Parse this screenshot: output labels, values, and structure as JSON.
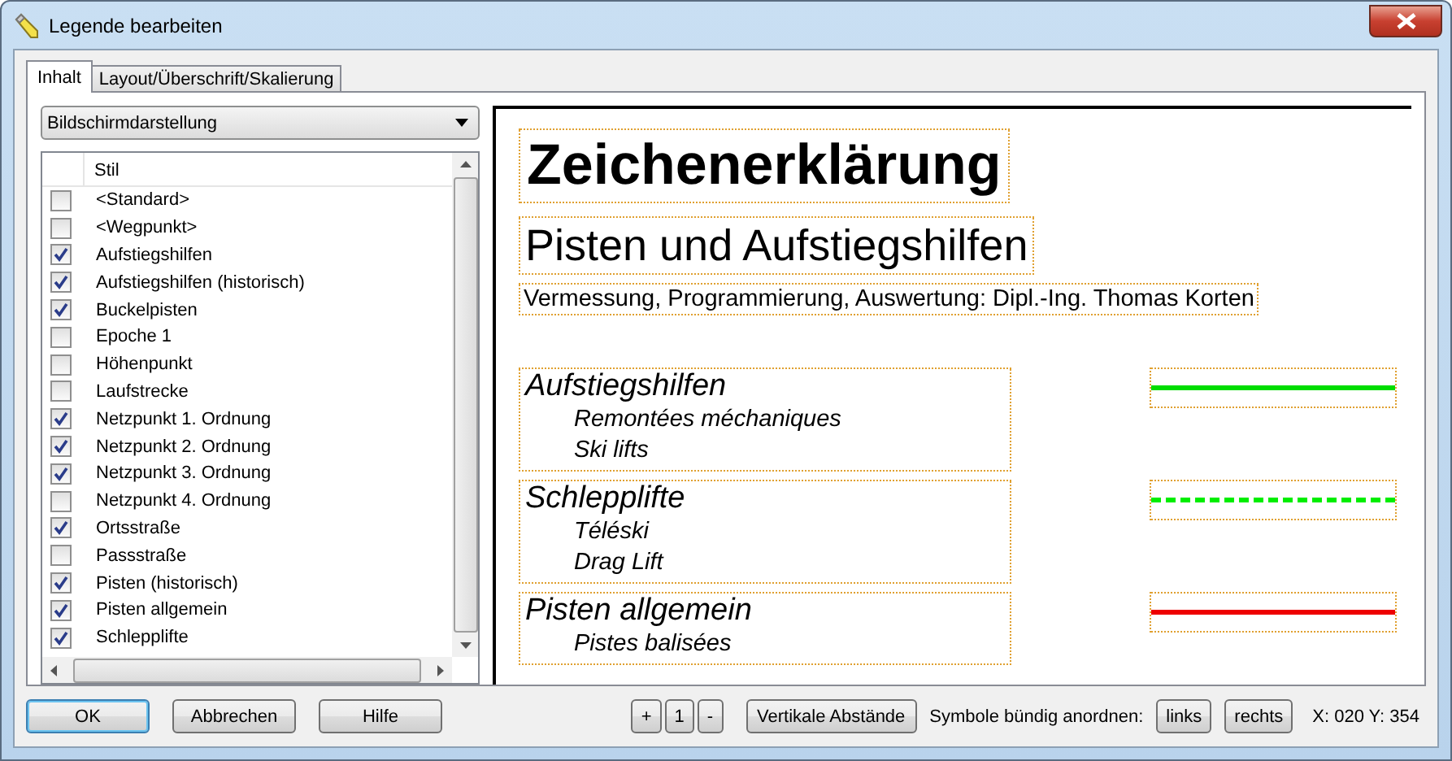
{
  "window": {
    "title": "Legende bearbeiten"
  },
  "tabs": [
    {
      "label": "Inhalt",
      "selected": true
    },
    {
      "label": "Layout/Überschrift/Skalierung",
      "selected": false
    }
  ],
  "dropdown": {
    "value": "Bildschirmdarstellung"
  },
  "style_list": {
    "column": "Stil",
    "items": [
      {
        "label": "<Standard>",
        "checked": false
      },
      {
        "label": "<Wegpunkt>",
        "checked": false
      },
      {
        "label": "Aufstiegshilfen",
        "checked": true
      },
      {
        "label": "Aufstiegshilfen (historisch)",
        "checked": true
      },
      {
        "label": "Buckelpisten",
        "checked": true
      },
      {
        "label": "Epoche 1",
        "checked": false
      },
      {
        "label": "Höhenpunkt",
        "checked": false
      },
      {
        "label": "Laufstrecke",
        "checked": false
      },
      {
        "label": "Netzpunkt 1. Ordnung",
        "checked": true
      },
      {
        "label": "Netzpunkt 2. Ordnung",
        "checked": true
      },
      {
        "label": "Netzpunkt 3. Ordnung",
        "checked": true
      },
      {
        "label": "Netzpunkt 4. Ordnung",
        "checked": false
      },
      {
        "label": "Ortsstraße",
        "checked": true
      },
      {
        "label": "Passstraße",
        "checked": false
      },
      {
        "label": "Pisten (historisch)",
        "checked": true
      },
      {
        "label": "Pisten allgemein",
        "checked": true
      },
      {
        "label": "Schlepplifte",
        "checked": true
      }
    ]
  },
  "preview": {
    "title": "Zeichenerklärung",
    "subtitle": "Pisten und Aufstiegshilfen",
    "credit": "Vermessung, Programmierung, Auswertung: Dipl.-Ing. Thomas Korten",
    "entries": [
      {
        "name": "Aufstiegshilfen",
        "lines": [
          "Remontées méchaniques",
          "Ski lifts"
        ],
        "kind": "solid",
        "color": "#00dd00"
      },
      {
        "name": "Schlepplifte",
        "lines": [
          "Téléski",
          "Drag Lift"
        ],
        "kind": "dashed",
        "color": "#00ee00"
      },
      {
        "name": "Pisten allgemein",
        "lines": [
          "Pistes balisées"
        ],
        "kind": "solid",
        "color": "#ee0000"
      }
    ]
  },
  "buttons": {
    "ok": "OK",
    "cancel": "Abbrechen",
    "help": "Hilfe",
    "plus": "+",
    "one": "1",
    "minus": "-",
    "spacing": "Vertikale Abstände",
    "align_label": "Symbole bündig anordnen:",
    "left": "links",
    "right": "rechts",
    "coords": "X: 020  Y: 354"
  }
}
